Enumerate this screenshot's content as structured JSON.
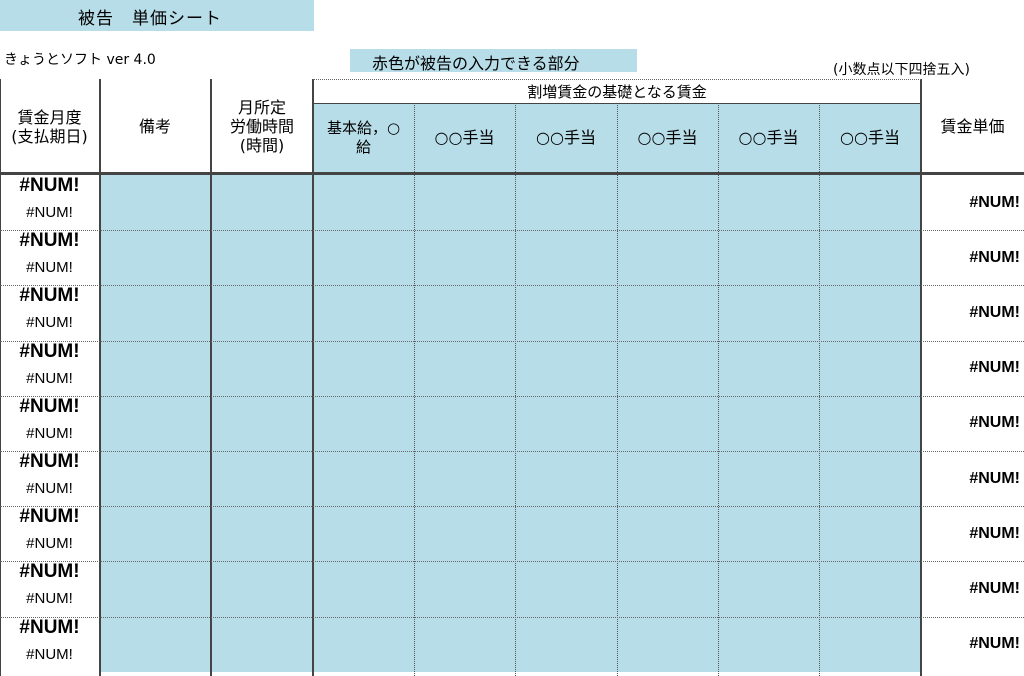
{
  "sheet": {
    "title": "被告　単価シート",
    "subtitle": "きょうとソフト ver 4.0",
    "input_note": "赤色が被告の入力できる部分",
    "rounding_note": "(小数点以下四捨五入)"
  },
  "headers": {
    "wage_month": "賃金月度\n(支払期日)",
    "remarks": "備考",
    "work_hours": "月所定\n労働時間\n(時間)",
    "group": "割増賃金の基礎となる賃金",
    "basic_pay": "基本給，○\n給",
    "allowance1": "○○手当",
    "allowance2": "○○手当",
    "allowance3": "○○手当",
    "allowance4": "○○手当",
    "allowance5": "○○手当",
    "wage_unit": "賃金単価"
  },
  "rows": [
    {
      "date_top": "#NUM!",
      "date_bottom": "#NUM!",
      "wage_unit": "#NUM!"
    },
    {
      "date_top": "#NUM!",
      "date_bottom": "#NUM!",
      "wage_unit": "#NUM!"
    },
    {
      "date_top": "#NUM!",
      "date_bottom": "#NUM!",
      "wage_unit": "#NUM!"
    },
    {
      "date_top": "#NUM!",
      "date_bottom": "#NUM!",
      "wage_unit": "#NUM!"
    },
    {
      "date_top": "#NUM!",
      "date_bottom": "#NUM!",
      "wage_unit": "#NUM!"
    },
    {
      "date_top": "#NUM!",
      "date_bottom": "#NUM!",
      "wage_unit": "#NUM!"
    },
    {
      "date_top": "#NUM!",
      "date_bottom": "#NUM!",
      "wage_unit": "#NUM!"
    },
    {
      "date_top": "#NUM!",
      "date_bottom": "#NUM!",
      "wage_unit": "#NUM!"
    },
    {
      "date_top": "#NUM!",
      "date_bottom": "#NUM!",
      "wage_unit": "#NUM!"
    }
  ],
  "colors": {
    "input_fill": "#b7dde8",
    "grid_line": "#000000"
  }
}
